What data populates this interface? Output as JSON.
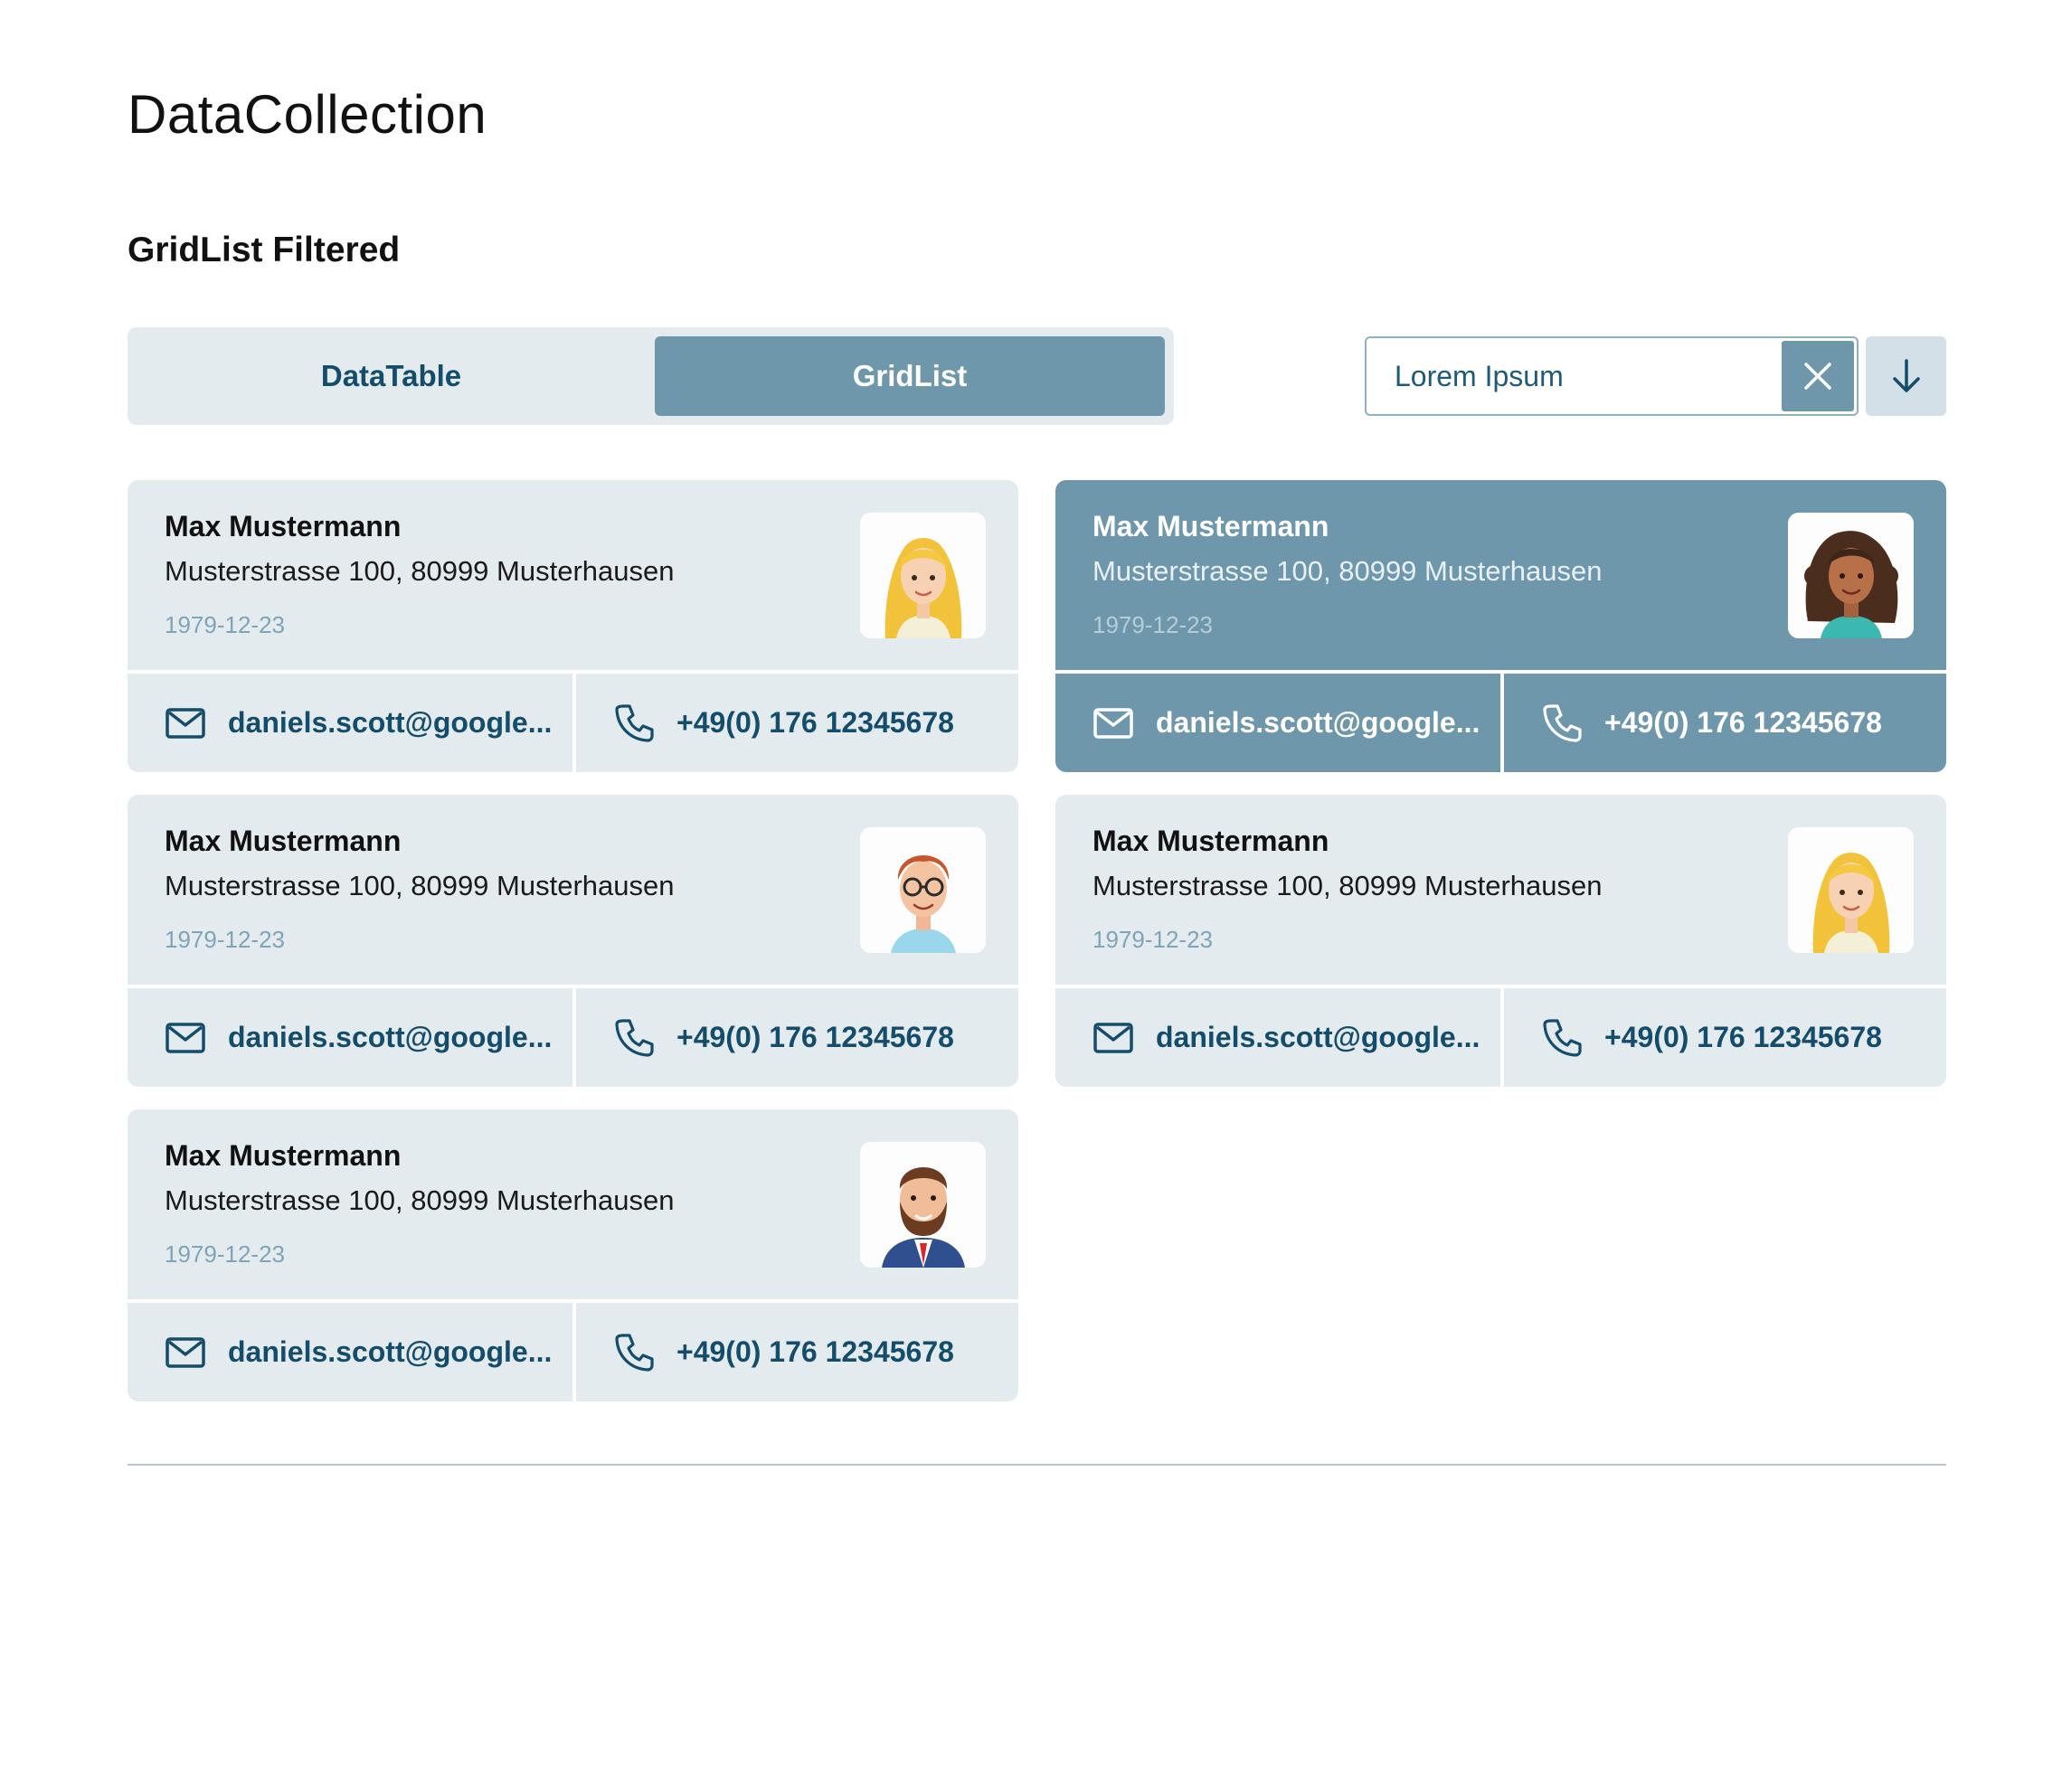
{
  "page_title": "DataCollection",
  "section_title": "GridList Filtered",
  "view_switch": {
    "tabs": [
      {
        "label": "DataTable",
        "active": false
      },
      {
        "label": "GridList",
        "active": true
      }
    ]
  },
  "search": {
    "value": "Lorem Ipsum",
    "clear_icon": "close-icon",
    "sort_icon": "arrow-down-icon"
  },
  "colors": {
    "accent": "#6e97ab",
    "card_bg": "#e4ebef",
    "text_link": "#134d6b",
    "date": "#7fa4b7"
  },
  "cards": [
    {
      "name": "Max Mustermann",
      "address": "Musterstrasse 100, 80999 Musterhausen",
      "date": "1979-12-23",
      "email": "daniels.scott@google...",
      "phone": "+49(0) 176 12345678",
      "avatar": "woman-blonde-avatar",
      "selected": false
    },
    {
      "name": "Max Mustermann",
      "address": "Musterstrasse 100, 80999 Musterhausen",
      "date": "1979-12-23",
      "email": "daniels.scott@google...",
      "phone": "+49(0) 176 12345678",
      "avatar": "woman-curly-hair-avatar",
      "selected": true
    },
    {
      "name": "Max Mustermann",
      "address": "Musterstrasse 100, 80999 Musterhausen",
      "date": "1979-12-23",
      "email": "daniels.scott@google...",
      "phone": "+49(0) 176 12345678",
      "avatar": "man-glasses-avatar",
      "selected": false
    },
    {
      "name": "Max Mustermann",
      "address": "Musterstrasse 100, 80999 Musterhausen",
      "date": "1979-12-23",
      "email": "daniels.scott@google...",
      "phone": "+49(0) 176 12345678",
      "avatar": "woman-blonde-avatar",
      "selected": false
    },
    {
      "name": "Max Mustermann",
      "address": "Musterstrasse 100, 80999 Musterhausen",
      "date": "1979-12-23",
      "email": "daniels.scott@google...",
      "phone": "+49(0) 176 12345678",
      "avatar": "man-beard-avatar",
      "selected": false
    }
  ]
}
